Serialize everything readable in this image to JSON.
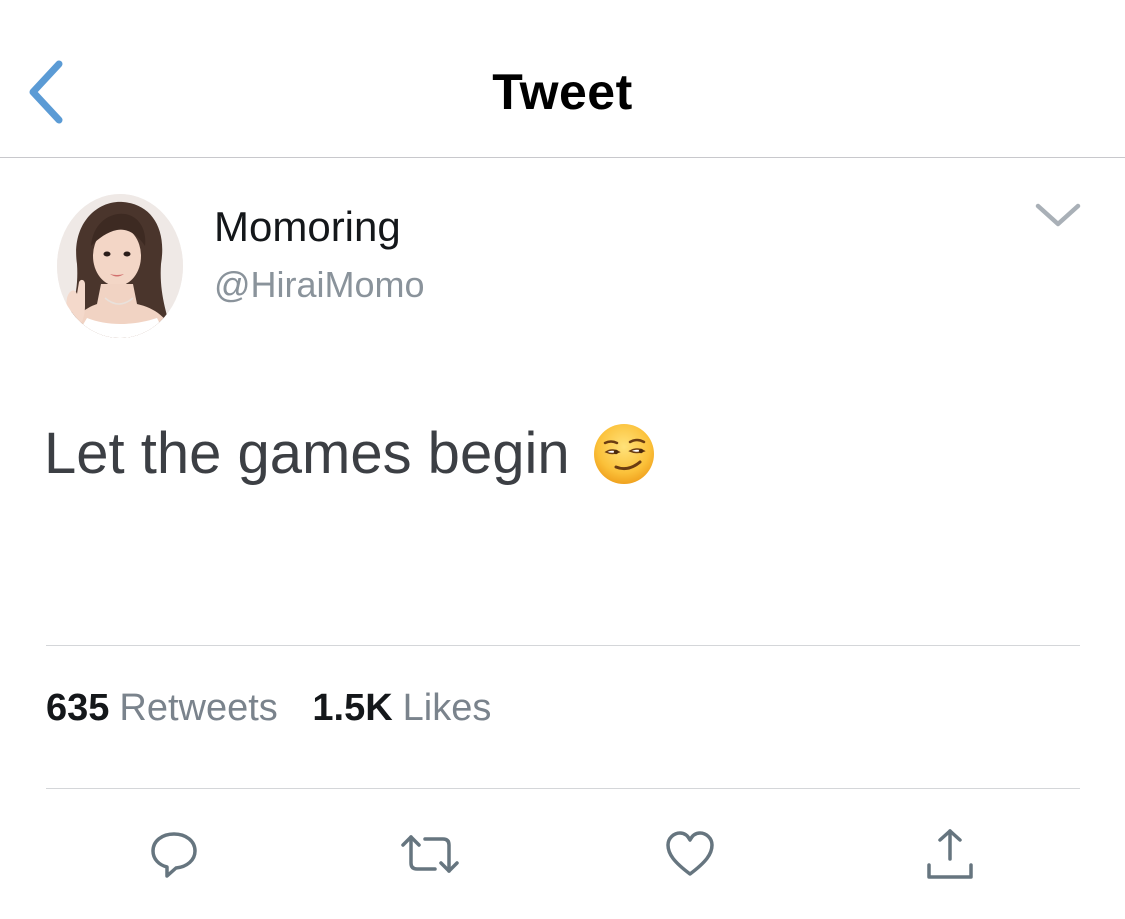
{
  "header": {
    "title": "Tweet",
    "back_icon": "chevron-left-icon"
  },
  "colors": {
    "accent": "#5b9bd5",
    "text_primary": "#14171a",
    "text_secondary": "#8a939b",
    "icon_gray": "#66757f",
    "divider": "#d4d6d9"
  },
  "author": {
    "display_name": "Momoring",
    "handle": "@HiraiMomo",
    "avatar_icon": "avatar",
    "menu_icon": "chevron-down-icon"
  },
  "tweet": {
    "text": "Let the games begin",
    "emoji": "smirking-face-emoji"
  },
  "stats": {
    "retweets_count": "635",
    "retweets_label": "Retweets",
    "likes_count": "1.5K",
    "likes_label": "Likes"
  },
  "actions": {
    "reply_icon": "reply-icon",
    "retweet_icon": "retweet-icon",
    "like_icon": "heart-icon",
    "share_icon": "share-icon"
  }
}
